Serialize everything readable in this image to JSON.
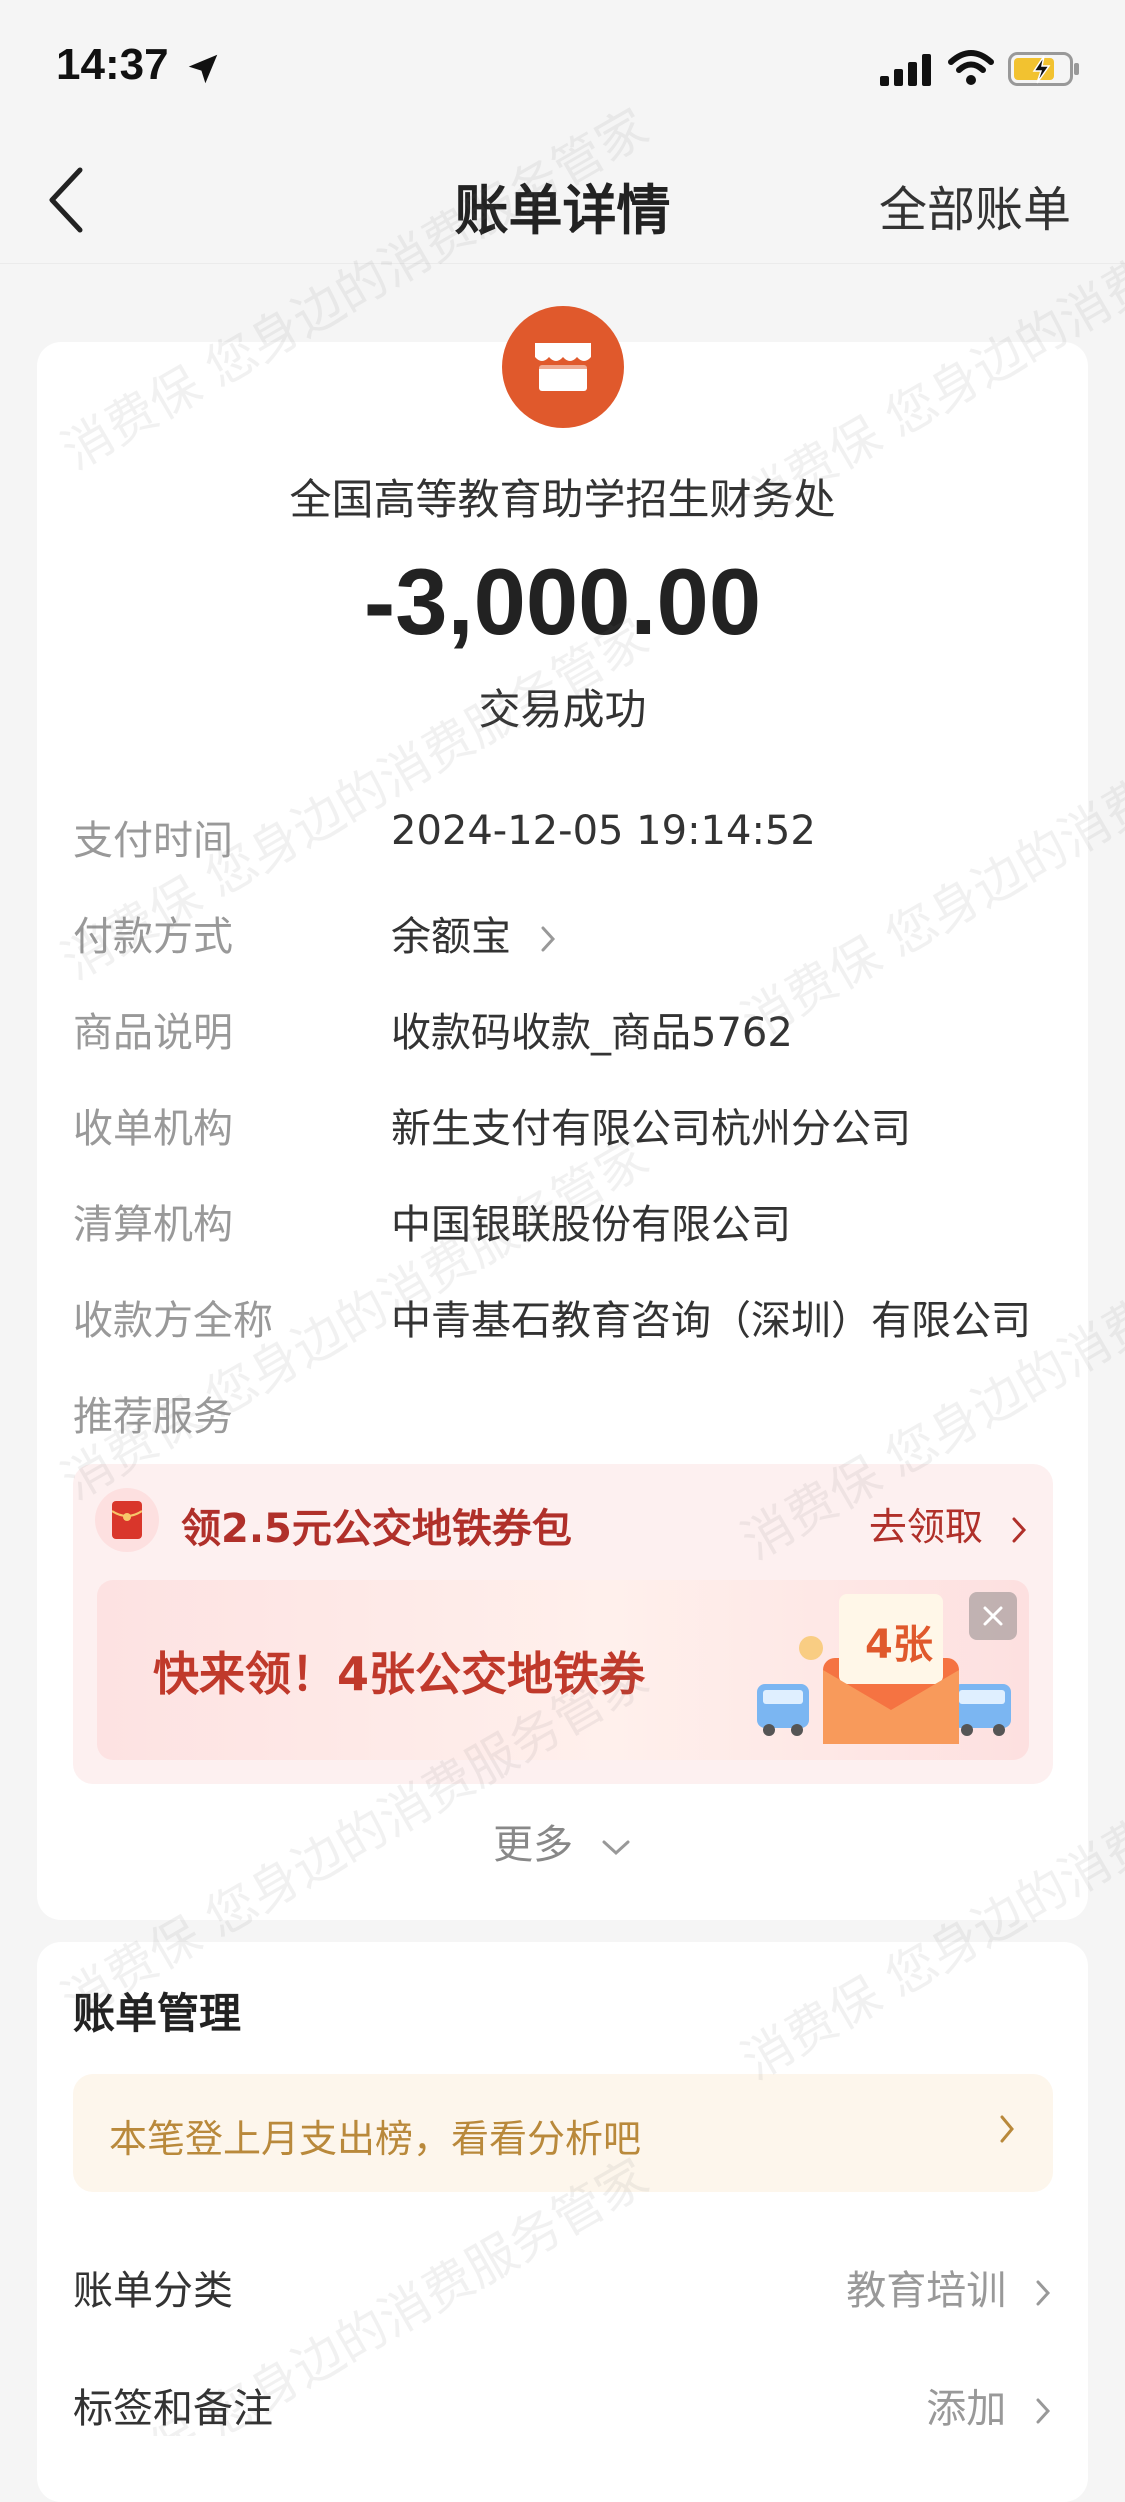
{
  "status_bar": {
    "time": "14:37"
  },
  "nav": {
    "title": "账单详情",
    "right_action": "全部账单"
  },
  "transaction": {
    "merchant": "全国高等教育助学招生财务处",
    "amount": "-3,000.00",
    "status": "交易成功"
  },
  "details": [
    {
      "label": "支付时间",
      "value": "2024-12-05 19:14:52"
    },
    {
      "label": "付款方式",
      "value": "余额宝"
    },
    {
      "label": "商品说明",
      "value": "收款码收款_商品5762"
    },
    {
      "label": "收单机构",
      "value": "新生支付有限公司杭州分公司"
    },
    {
      "label": "清算机构",
      "value": "中国银联股份有限公司"
    },
    {
      "label": "收款方全称",
      "value": "中青基石教育咨询（深圳）有限公司"
    },
    {
      "label": "推荐服务",
      "value": ""
    }
  ],
  "promo": {
    "title": "领2.5元公交地铁券包",
    "claim": "去领取",
    "banner_text": "快来领！4张公交地铁券",
    "envelope_label": "4张"
  },
  "more_label": "更多",
  "manage": {
    "title": "账单管理",
    "insight": "本笔登上月支出榜，看看分析吧",
    "rows": [
      {
        "label": "账单分类",
        "value": "教育培训"
      },
      {
        "label": "标签和备注",
        "value": "添加"
      }
    ]
  },
  "watermark": "消费保 您身边的消费服务管家",
  "colors": {
    "merchant_avatar": "#e0592c",
    "promo_red": "#b0302a",
    "insight_gold": "#b9893b"
  }
}
